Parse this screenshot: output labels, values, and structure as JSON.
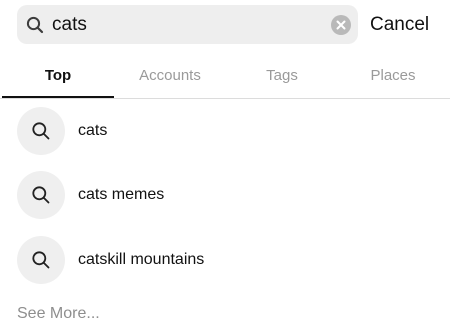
{
  "search": {
    "query": "cats",
    "cancel_label": "Cancel"
  },
  "tabs": [
    {
      "label": "Top",
      "active": true
    },
    {
      "label": "Accounts",
      "active": false
    },
    {
      "label": "Tags",
      "active": false
    },
    {
      "label": "Places",
      "active": false
    }
  ],
  "suggestions": [
    {
      "label": "cats",
      "icon": "search-icon"
    },
    {
      "label": "cats memes",
      "icon": "search-icon"
    },
    {
      "label": "catskill mountains",
      "icon": "search-icon"
    }
  ],
  "see_more_label": "See More...",
  "colors": {
    "field_bg": "#eeeeee",
    "text": "#111111",
    "muted": "#9a9a9a",
    "icon_circle": "#efefef"
  }
}
